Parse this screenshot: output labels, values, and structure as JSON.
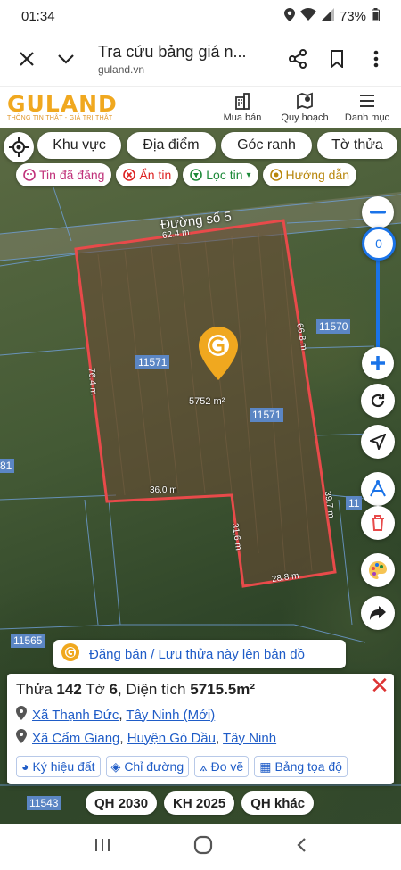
{
  "status": {
    "time": "01:34",
    "battery": "73%"
  },
  "browser": {
    "title": "Tra cứu bảng giá n...",
    "url": "guland.vn"
  },
  "header": {
    "logo": "GULAND",
    "tagline": "THÔNG TIN THẬT - GIÁ TRỊ THẬT",
    "nav": [
      {
        "label": "Mua bán"
      },
      {
        "label": "Quy hoạch"
      },
      {
        "label": "Danh mục"
      }
    ]
  },
  "filters": {
    "khu_vuc": "Khu vực",
    "dia_diem": "Địa điểm",
    "goc_ranh": "Góc ranh",
    "to_thua": "Tờ thửa",
    "tin_da_dang": "Tin đã đăng",
    "an_tin": "Ẩn tin",
    "loc_tin": "Lọc tin",
    "huong_dan": "Hướng dẫn"
  },
  "map": {
    "road_name": "Đường số 5",
    "zoom_level": "0",
    "area_label": "5752 m²",
    "plot_labels": {
      "main_a": "11571",
      "main_b": "11571",
      "east": "11570",
      "sw": "11565",
      "bottom": "11543",
      "west": "81",
      "right_edge": "11"
    },
    "dimensions": {
      "top": "62.4 m",
      "right_upper": "66.8 m",
      "left": "76.4 m",
      "notch_h": "36.0 m",
      "notch_v": "31.6 m",
      "bottom": "28.8 m",
      "right_lower": "39.7 m"
    }
  },
  "banner": {
    "text": "Đăng bán / Lưu thửa này lên bản đồ"
  },
  "info": {
    "thua_label": "Thửa",
    "thua": "142",
    "to_label": "Tờ",
    "to": "6",
    "dien_tich_label": ", Diện tích",
    "dien_tich": "5715.5m²",
    "addr1": {
      "xa": "Xã Thạnh Đức",
      "tinh": "Tây Ninh (Mới)"
    },
    "addr2": {
      "xa": "Xã Cẩm Giang",
      "huyen": "Huyện Gò Dầu",
      "tinh": "Tây Ninh"
    },
    "tools": {
      "ky_hieu": "Ký hiệu đất",
      "chi_duong": "Chỉ đường",
      "do_ve": "Đo vẽ",
      "bang_toa_do": "Bảng tọa độ"
    }
  },
  "planning": {
    "qh2030": "QH 2030",
    "kh2025": "KH 2025",
    "qh_khac": "QH khác"
  },
  "colors": {
    "accent": "#f0a81f",
    "link": "#1f5cc7",
    "plot_border": "#e84a4a",
    "zoom_blue": "#1a73e8"
  }
}
